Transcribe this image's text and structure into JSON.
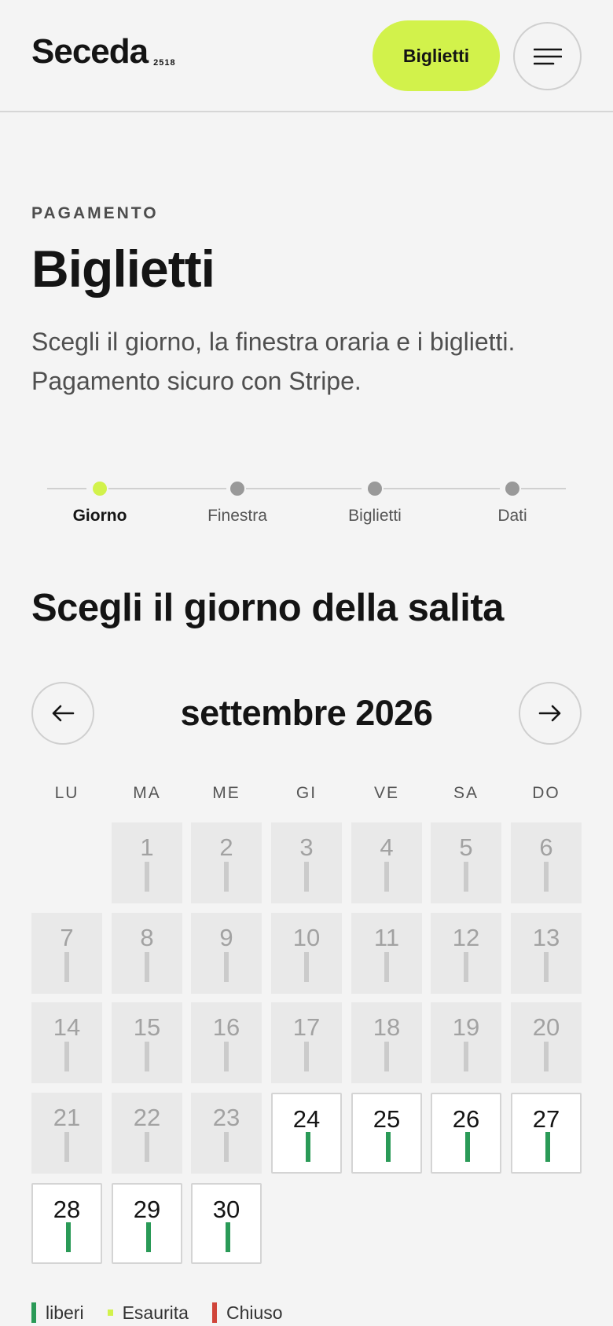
{
  "header": {
    "logo": "Seceda",
    "logo_sup": "2518",
    "tickets_button": "Biglietti",
    "menu_icon": "hamburger-menu-icon"
  },
  "intro": {
    "eyebrow": "PAGAMENTO",
    "title": "Biglietti",
    "subtitle": "Scegli il giorno, la finestra oraria e i biglietti. Pagamento sicuro con Stripe."
  },
  "stepper": {
    "steps": [
      "Giorno",
      "Finestra",
      "Biglietti",
      "Dati"
    ],
    "active_index": 0
  },
  "calendar": {
    "section_title": "Scegli il giorno della salita",
    "month": "settembre 2026",
    "prev_icon": "arrow-left-icon",
    "next_icon": "arrow-right-icon",
    "weekdays": [
      "LU",
      "MA",
      "ME",
      "GI",
      "VE",
      "SA",
      "DO"
    ],
    "first_weekday_offset": 1,
    "past_days": [
      1,
      2,
      3,
      4,
      5,
      6,
      7,
      8,
      9,
      10,
      11,
      12,
      13,
      14,
      15,
      16,
      17,
      18,
      19,
      20,
      21,
      22,
      23
    ],
    "available_days": [
      24,
      25,
      26,
      27,
      28,
      29,
      30
    ]
  },
  "legend": [
    {
      "label": "liberi",
      "color": "#2a9a57"
    },
    {
      "label": "Esaurita",
      "color": "#d2f24b"
    },
    {
      "label": "Chiuso",
      "color": "#d0453a"
    }
  ],
  "colors": {
    "accent": "#d2f24b",
    "available": "#2a9a57",
    "closed": "#d0453a",
    "background": "#f4f4f4"
  }
}
